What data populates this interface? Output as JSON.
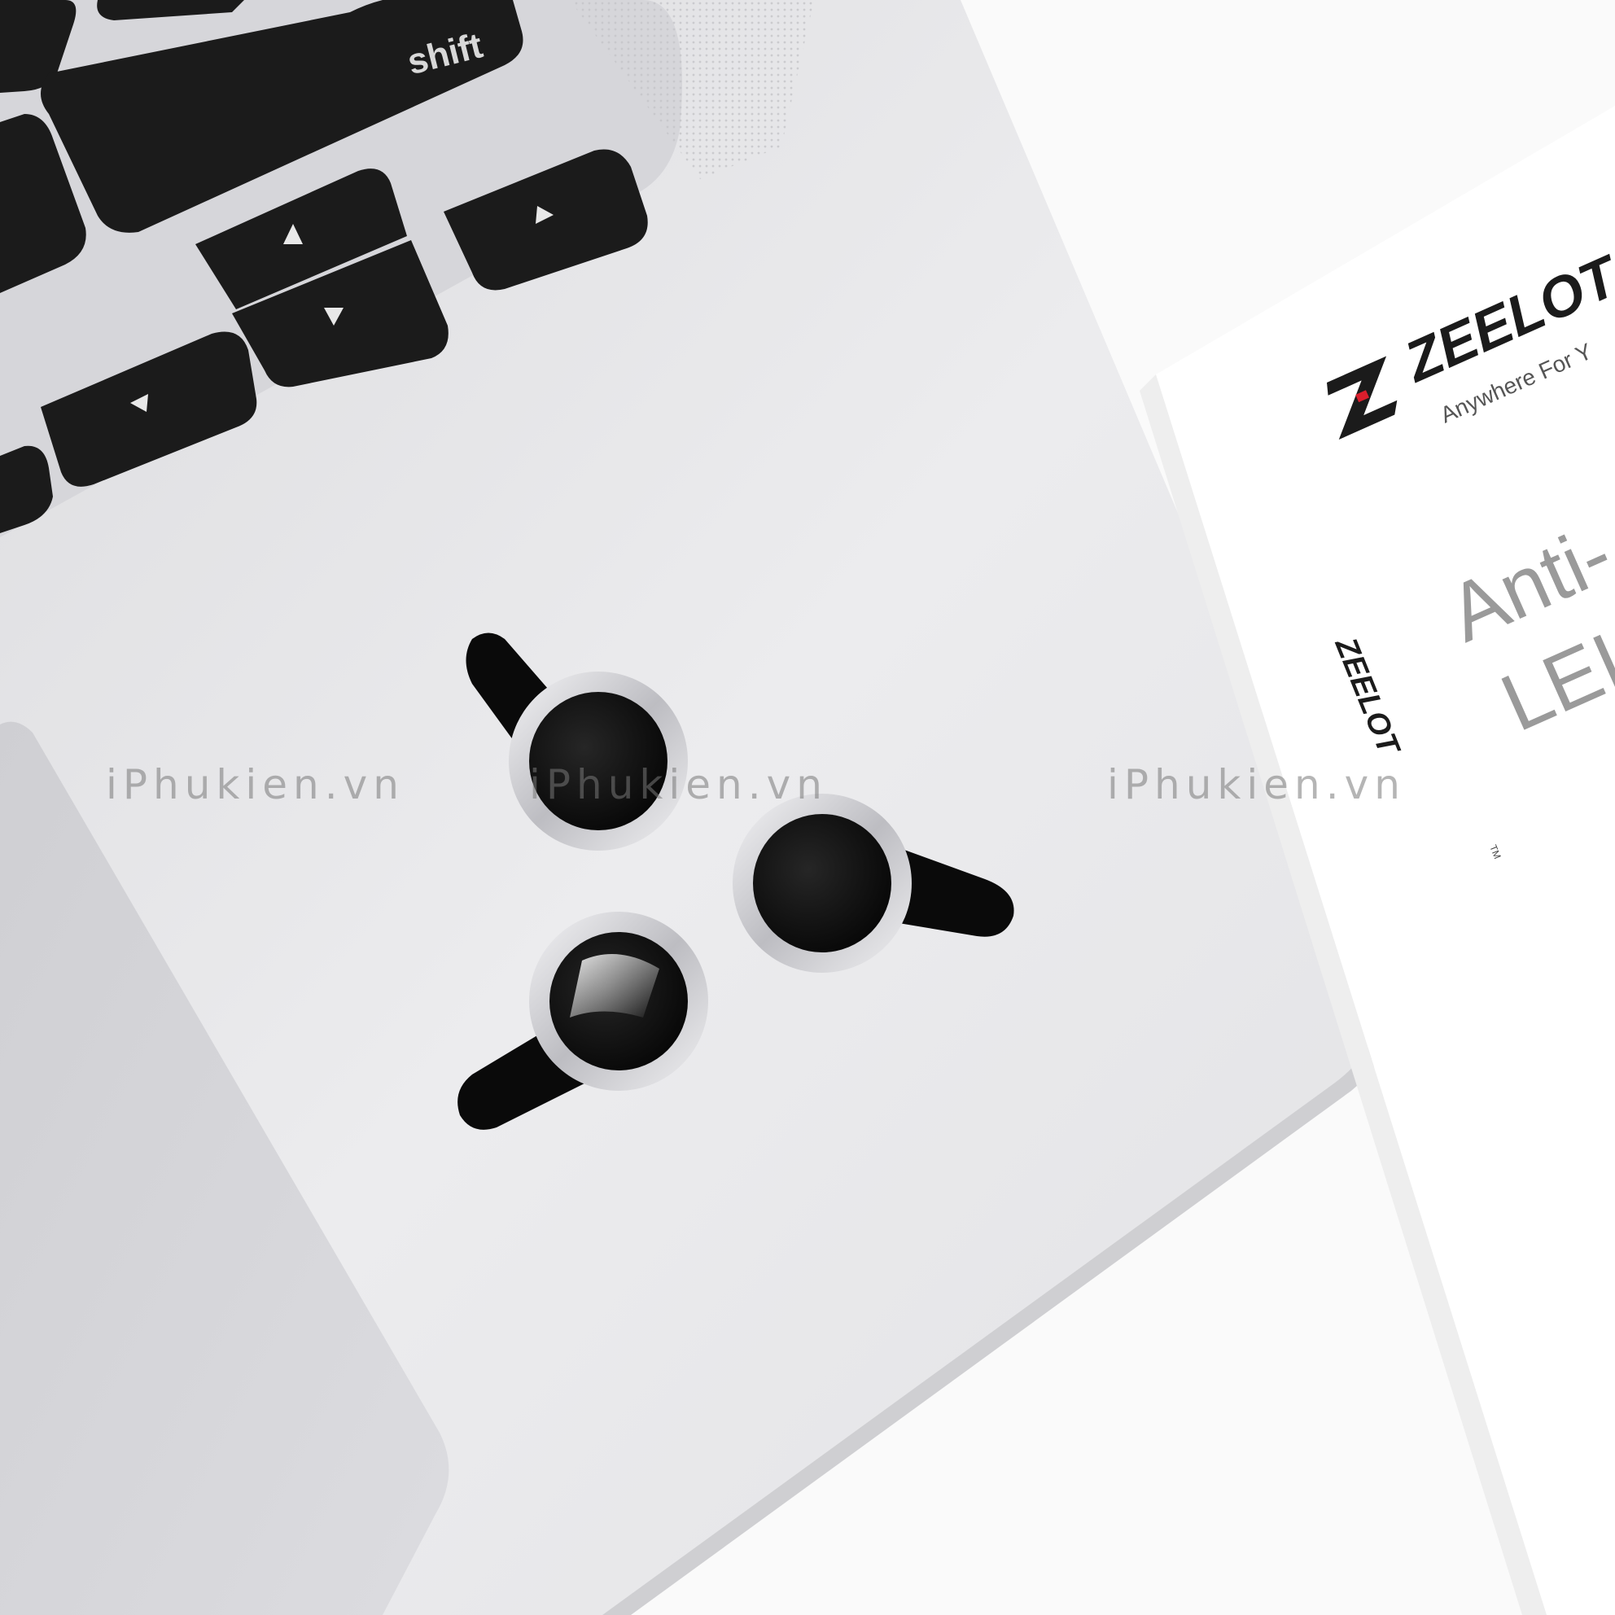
{
  "keyboard": {
    "shift_label": "shift"
  },
  "box": {
    "brand": "ZEELOT",
    "tagline": "Anywhere For Y",
    "product_line_1": "Anti-",
    "product_line_2": "LEI",
    "side_brand": "ZEELOT",
    "trademark": "TM"
  },
  "watermark": {
    "text": "iPhukien.vn"
  },
  "colors": {
    "background": "#fafafa",
    "laptop_aluminum": "#e6e6e8",
    "key_black": "#1b1b1b",
    "lens_ring": "#d8d8dc",
    "box_white": "#ffffff"
  },
  "objects": {
    "lens_count": 3,
    "lens_icons": [
      "camera-lens-protector",
      "camera-lens-protector",
      "camera-lens-protector"
    ]
  }
}
